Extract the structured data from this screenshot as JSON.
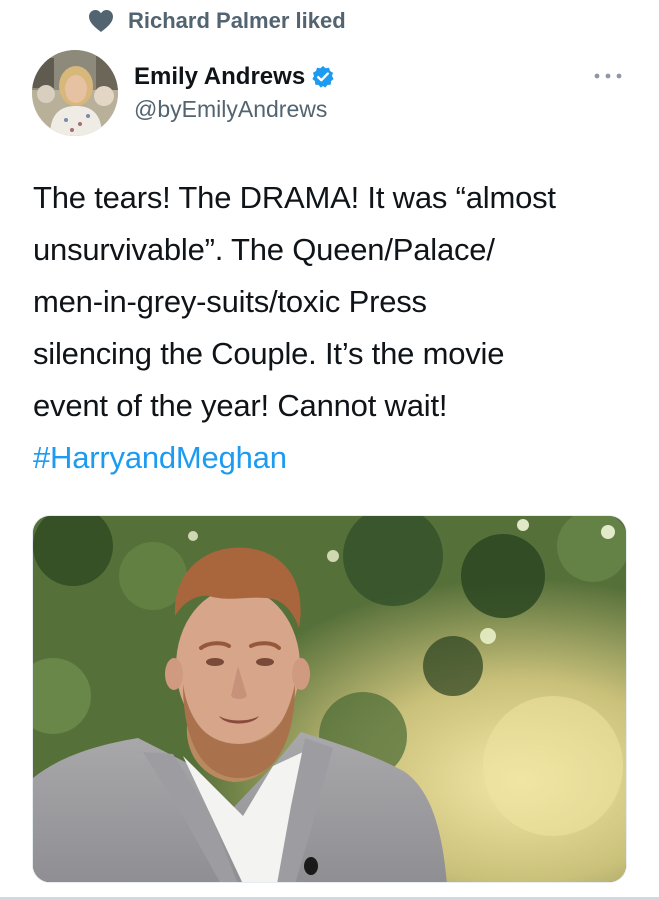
{
  "social_context": {
    "text": "Richard Palmer liked",
    "icon": "heart-icon"
  },
  "author": {
    "display_name": "Emily Andrews",
    "handle": "@byEmilyAndrews",
    "verified": true,
    "avatar_description": "avatar-photo"
  },
  "tweet": {
    "lines": [
      "The tears! The DRAMA! It was “almost",
      "unsurvivable”. The Queen/Palace/",
      "men-in-grey-suits/toxic Press",
      "silencing the Couple. It’s the movie",
      "event of the year! Cannot wait!"
    ],
    "hashtag": "#HarryandMeghan"
  },
  "colors": {
    "link": "#1d9bf0",
    "secondary_text": "#536471",
    "verified": "#1d9bf0"
  }
}
